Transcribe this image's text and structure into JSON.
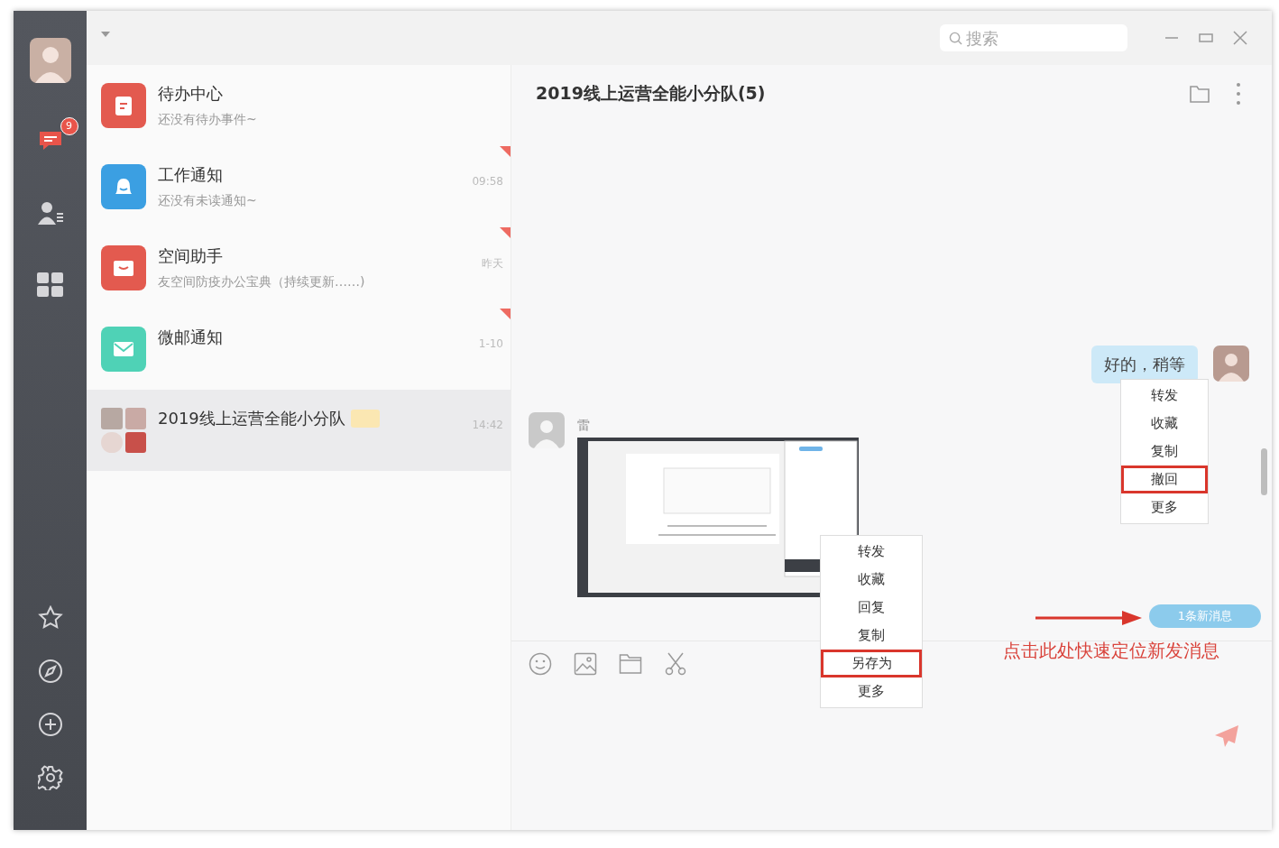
{
  "sidebar": {
    "items": [
      {
        "kind": "messages",
        "selected": true,
        "badge": "9"
      },
      {
        "kind": "contacts",
        "selected": false
      },
      {
        "kind": "apps",
        "selected": false
      }
    ],
    "bottom_items": [
      {
        "kind": "star"
      },
      {
        "kind": "compass"
      },
      {
        "kind": "add"
      },
      {
        "kind": "settings"
      }
    ]
  },
  "search": {
    "placeholder": "搜索"
  },
  "conversations": [
    {
      "kind": "todo",
      "color": "#e35a4f",
      "title": "待办中心",
      "subtitle": "还没有待办事件~",
      "pinned": false,
      "selected": false,
      "tagged": false
    },
    {
      "kind": "bell",
      "color": "#3b9fe2",
      "title": "工作通知",
      "subtitle": "还没有未读通知~",
      "time": "09:58",
      "pinned": true,
      "selected": false,
      "tagged": false
    },
    {
      "kind": "inbox",
      "color": "#e35a4f",
      "title": "空间助手",
      "subtitle": "友空间防疫办公宝典（持续更新……)",
      "time": "昨天",
      "pinned": true,
      "selected": false,
      "tagged": false
    },
    {
      "kind": "mail",
      "color": "#4fd2b6",
      "title": "微邮通知",
      "time": "1-10",
      "pinned": true,
      "selected": false,
      "tagged": false
    },
    {
      "kind": "group",
      "title": "2019线上运营全能小分队",
      "time": "14:42",
      "pinned": false,
      "selected": true,
      "tagged": true
    }
  ],
  "chat": {
    "title": "2019线上运营全能小分队(5)",
    "messages": [
      {
        "kind": "text",
        "text": "好的，稍等",
        "menu": [
          {
            "label": "转发",
            "highlighted": false
          },
          {
            "label": "收藏",
            "highlighted": false
          },
          {
            "label": "复制",
            "highlighted": false
          },
          {
            "label": "撤回",
            "highlighted": true
          },
          {
            "label": "更多",
            "highlighted": false
          }
        ]
      },
      {
        "kind": "image",
        "sender": "雷",
        "menu": [
          {
            "label": "转发",
            "highlighted": false
          },
          {
            "label": "收藏",
            "highlighted": false
          },
          {
            "label": "回复",
            "highlighted": false
          },
          {
            "label": "复制",
            "highlighted": false
          },
          {
            "label": "另存为",
            "highlighted": true
          },
          {
            "label": "更多",
            "highlighted": false
          }
        ]
      }
    ],
    "new_messages": "1条新消息",
    "annotation": "点击此处快速定位新发消息"
  }
}
